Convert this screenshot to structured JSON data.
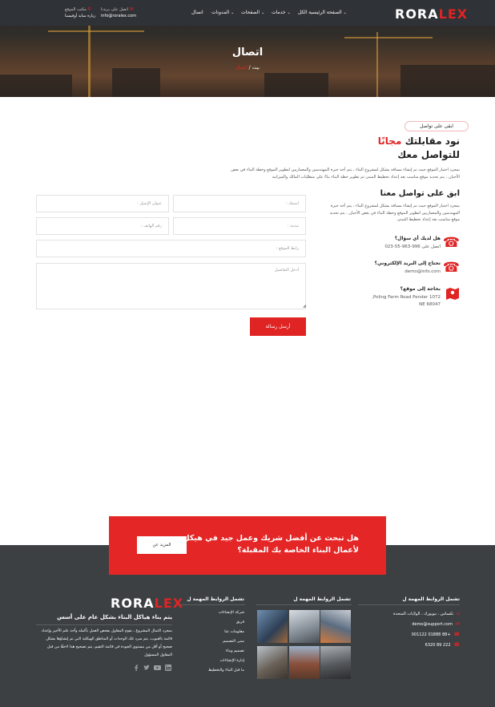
{
  "header": {
    "logo_white": "RORA",
    "logo_red": "LEX",
    "nav": [
      {
        "label": "الصفحة الرئيسية الكل",
        "has_dropdown": true
      },
      {
        "label": "خدمات",
        "has_dropdown": true
      },
      {
        "label": "الصفحات",
        "has_dropdown": true
      },
      {
        "label": "المدونات",
        "has_dropdown": true
      },
      {
        "label": "اتصال",
        "has_dropdown": false
      }
    ],
    "email_label": "اتصل على بريدنا",
    "email_value": "info@roralex.com",
    "location_label": "مكتب الموقع",
    "location_value": "زيارة سايد أوفيسنا"
  },
  "hero": {
    "title": "اتصال",
    "crumb_home": "بيت",
    "crumb_sep": "/",
    "crumb_current": "اتصال"
  },
  "contact": {
    "pill": "ابقى على تواصل",
    "heading_line1_black": "نود مقابلتك",
    "heading_line1_red": "مجانًا",
    "heading_line2": "للتواصل معك",
    "intro": "بمجرد اختيار الموقع حيث تم إنشاء مسافة بشكل لمشروع البناء ، يتم أخذ خبرة المهندسين والمعماريين لتطوير الموقع وخطة البناء في بعض الأحيان ، يتم تحديد موقع مناسب بعد إعداد تخطيط المبنى ثم تطوير خطة البناء بناءً على متطلبات المالك والميزانية",
    "sub_heading": "ابق على تواصل معنا",
    "sub_text": "بمجرد اختيار الموقع حيث تم إنشاء مسافة بشكل لمشروع البناء ، يتم أخذ خبرة المهندسين والمعماريين لتطوير الموقع وخطة البناء في بعض الأحيان ، يتم تحديد موقع مناسب بعد إعداد تخطيط المبنى",
    "info": [
      {
        "icon": "phone-icon",
        "q": "هل لديك أي سؤال؟",
        "a": "اتصل على 996-963-55-023"
      },
      {
        "icon": "phone-icon",
        "q": "تحتاج إلى البريد الإلكتروني؟",
        "a": "demo@info.com"
      },
      {
        "icon": "map-icon",
        "q": "بحاجة إلى موقع؟",
        "a1": "1072 Poling Farm Road Pender,",
        "a2": "NE 68047"
      }
    ]
  },
  "form": {
    "name_ph": "اسمك :",
    "email_ph": "عنوان الإيميل :",
    "city_ph": "مدينة :",
    "phone_ph": "رقم الهاتف :",
    "website_ph": "رابط الموقع :",
    "details_ph": "أدخل التفاصيل",
    "submit": "أرسل رسالة"
  },
  "cta": {
    "line1": "هل تبحث عن أفضل شريك وعمل جيد في هيكل",
    "line2": "لأعمال البناء الخاصة بك المقبلة؟",
    "button": "المزيد عن"
  },
  "footer": {
    "col1_heading": "تشمل الروابط المهمة ل",
    "col1_items": [
      {
        "icon": "location-icon",
        "text": "تكساس ، نيويورك ، الولايات المتحدة"
      },
      {
        "icon": "mail-icon",
        "text": "demo@support.com"
      },
      {
        "icon": "phone-icon",
        "text": "+88 01888 001122"
      },
      {
        "icon": "phone-icon",
        "text": "222 89 6320"
      }
    ],
    "col2_heading": "تشمل الروابط المهمة ل",
    "col3_heading": "تشمل الروابط المهمة ل",
    "col3_links": [
      "شركة الإنشاءات",
      "فريق",
      "معلومات عنا",
      "مبنى التصميم",
      "تصميم وبناء",
      "إدارة الإنشاءات",
      "ما قبل البناء والتخطيط"
    ],
    "logo_white": "RORA",
    "logo_red": "LEX",
    "tagline": "يتم بناء هياكل البناء بشكل عام على أسس",
    "desc": "بمجرد اكتمال المشروع ، يقوم المقاول بفحص العمل بأكمله وأخذ علم الأخير وإعداد قائمة بالعيوب. يتم سرد تلك الوحدات أو المناطق الهيكلية التي تم إنشاؤها بشكل صحيح أو أقل من مستوى الجودة في قائمة التقيم. يتم تصحيح هذا لاحقًا من قبل المقاول المسؤول",
    "social": [
      "linkedin-icon",
      "youtube-icon",
      "twitter-icon",
      "facebook-icon"
    ]
  }
}
